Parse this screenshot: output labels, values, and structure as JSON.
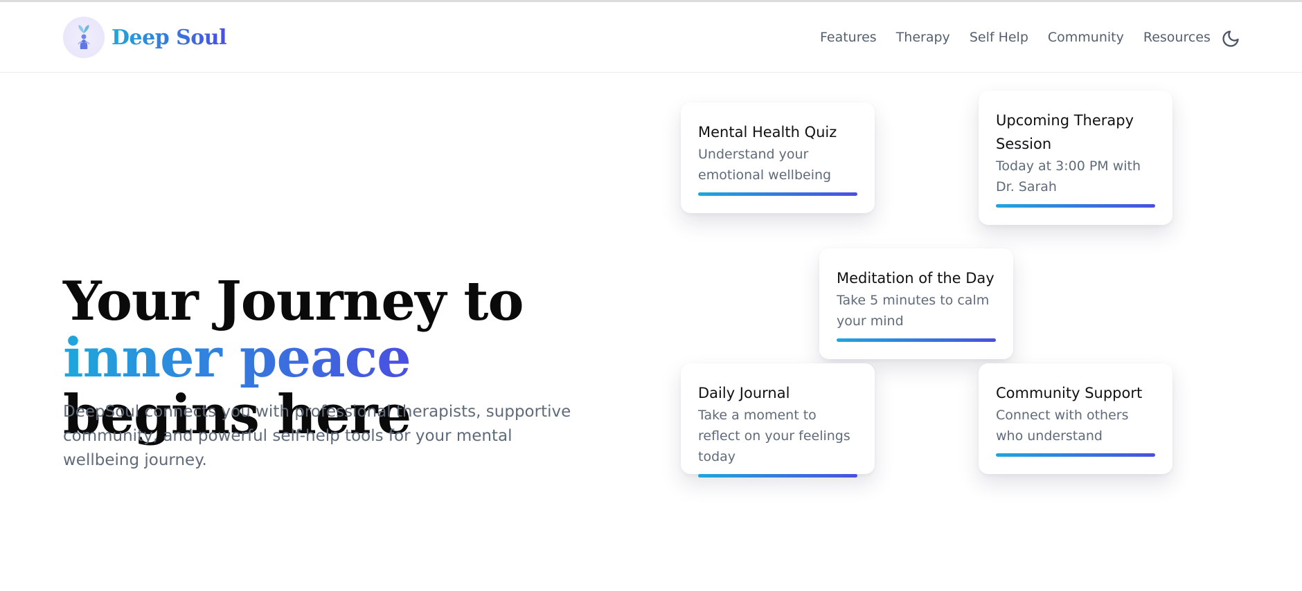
{
  "header": {
    "brand": "Deep Soul",
    "nav": [
      "Features",
      "Therapy",
      "Self Help",
      "Community",
      "Resources"
    ]
  },
  "hero": {
    "title_part1": "Your Journey to ",
    "title_highlight": "inner peace",
    "title_part2": " begins here",
    "subtitle": "DeepSoul connects you with professional therapists, supportive community, and powerful self-help tools for your mental wellbeing journey."
  },
  "cards": [
    {
      "title": "Mental Health Quiz",
      "text": "Understand your emotional wellbeing"
    },
    {
      "title": "Upcoming Therapy Session",
      "text": "Today at 3:00 PM with Dr. Sarah"
    },
    {
      "title": "Meditation of the Day",
      "text": "Take 5 minutes to calm your mind"
    },
    {
      "title": "Daily Journal",
      "text": "Take a moment to reflect on your feelings today"
    },
    {
      "title": "Community Support",
      "text": "Connect with others who understand"
    }
  ],
  "colors": {
    "accent_start": "#1ea7dc",
    "accent_end": "#4a4fe0",
    "text_muted": "#5f6b7a"
  },
  "icons": {
    "logo": "lotus-figure-icon",
    "theme_toggle": "moon-icon"
  }
}
